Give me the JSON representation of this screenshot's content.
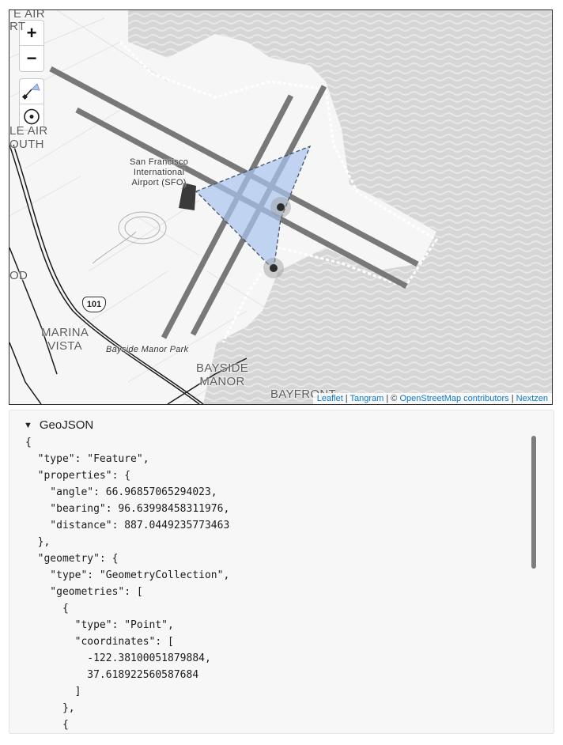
{
  "map": {
    "zoom_in_label": "+",
    "zoom_out_label": "−",
    "shield_label": "101",
    "labels": {
      "sfo": "San Francisco\nInternational\nAirport (SFO)",
      "air_top": "E AIR",
      "rt": "RT",
      "le_air": "LE AIR",
      "outh": "OUTH",
      "od": "OD",
      "marina_vista": "MARINA\nVISTA",
      "bayside_park": "Bayside Manor Park",
      "bayside_manor": "BAYSIDE\nMANOR",
      "bayfront": "BAYFRONT"
    },
    "attribution": {
      "leaflet": "Leaflet",
      "sep1": " | ",
      "tangram": "Tangram",
      "sep2": " | © ",
      "osm": "OpenStreetMap contributors",
      "sep3": " | ",
      "nextzen": "Nextzen"
    },
    "colors": {
      "water": "#d6d6d6",
      "runway": "#787878",
      "sector_fill": "#a9c4ef",
      "marker": "#3a3a3a"
    }
  },
  "geojson": {
    "summary": "GeoJSON",
    "lines": [
      "{",
      "  \"type\": \"Feature\",",
      "  \"properties\": {",
      "    \"angle\": 66.96857065294023,",
      "    \"bearing\": 96.63998458311976,",
      "    \"distance\": 887.0449235773463",
      "  },",
      "  \"geometry\": {",
      "    \"type\": \"GeometryCollection\",",
      "    \"geometries\": [",
      "      {",
      "        \"type\": \"Point\",",
      "        \"coordinates\": [",
      "          -122.38100051879884,",
      "          37.618922560587684",
      "        ]",
      "      },",
      "      {"
    ]
  }
}
